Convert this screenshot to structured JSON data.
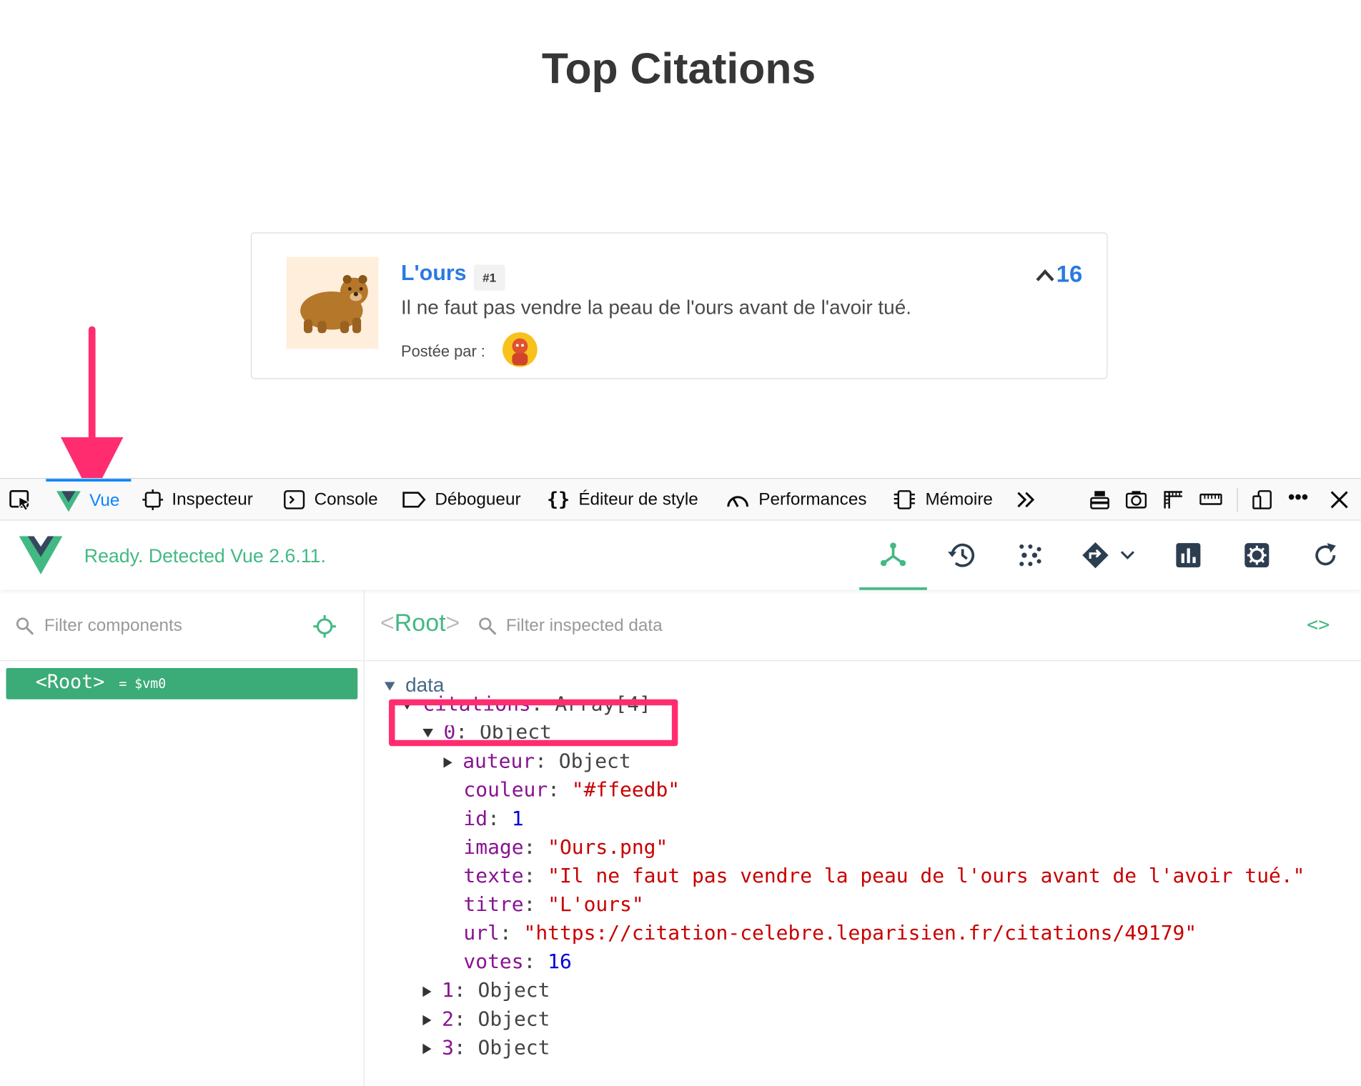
{
  "page": {
    "title": "Top Citations",
    "citation": {
      "title": "L'ours",
      "rank": "#1",
      "votes": "16",
      "text": "Il ne faut pas vendre la peau de l'ours avant de l'avoir tué.",
      "posted_by": "Postée par :"
    }
  },
  "devtools": {
    "tabs": [
      {
        "label": "Vue"
      },
      {
        "label": "Inspecteur"
      },
      {
        "label": "Console"
      },
      {
        "label": "Débogueur"
      },
      {
        "label": "Éditeur de style"
      },
      {
        "label": "Performances"
      },
      {
        "label": "Mémoire"
      }
    ],
    "vue": {
      "status": "Ready. Detected Vue 2.6.11."
    },
    "components": {
      "filter_placeholder": "Filter components",
      "root_name": "<Root>",
      "root_alias": "= $vm0"
    },
    "inspector": {
      "root_name": "Root",
      "filter_placeholder": "Filter inspected data",
      "code_icon": "<>",
      "section": "data",
      "tree": {
        "citations_key": "citations",
        "citations_type": "Array[4]",
        "item0_key": "0",
        "item0_type": "Object",
        "auteur_key": "auteur",
        "auteur_val": "Object",
        "couleur_key": "couleur",
        "couleur_val": "\"#ffeedb\"",
        "id_key": "id",
        "id_val": "1",
        "image_key": "image",
        "image_val": "\"Ours.png\"",
        "texte_key": "texte",
        "texte_val": "\"Il ne faut pas vendre la peau de l'ours avant de l'avoir tué.\"",
        "titre_key": "titre",
        "titre_val": "\"L'ours\"",
        "url_key": "url",
        "url_val": "\"https://citation-celebre.leparisien.fr/citations/49179\"",
        "votes_key": "votes",
        "votes_val": "16",
        "item1_key": "1",
        "item2_key": "2",
        "item3_key": "3",
        "object_label": "Object"
      }
    }
  },
  "colors": {
    "vue_green": "#42b983",
    "selected_row": "#3bab78",
    "annotation_pink": "#ff2d6f",
    "link_blue": "#2a7ae2",
    "thumb_bg": "#ffeedb"
  }
}
